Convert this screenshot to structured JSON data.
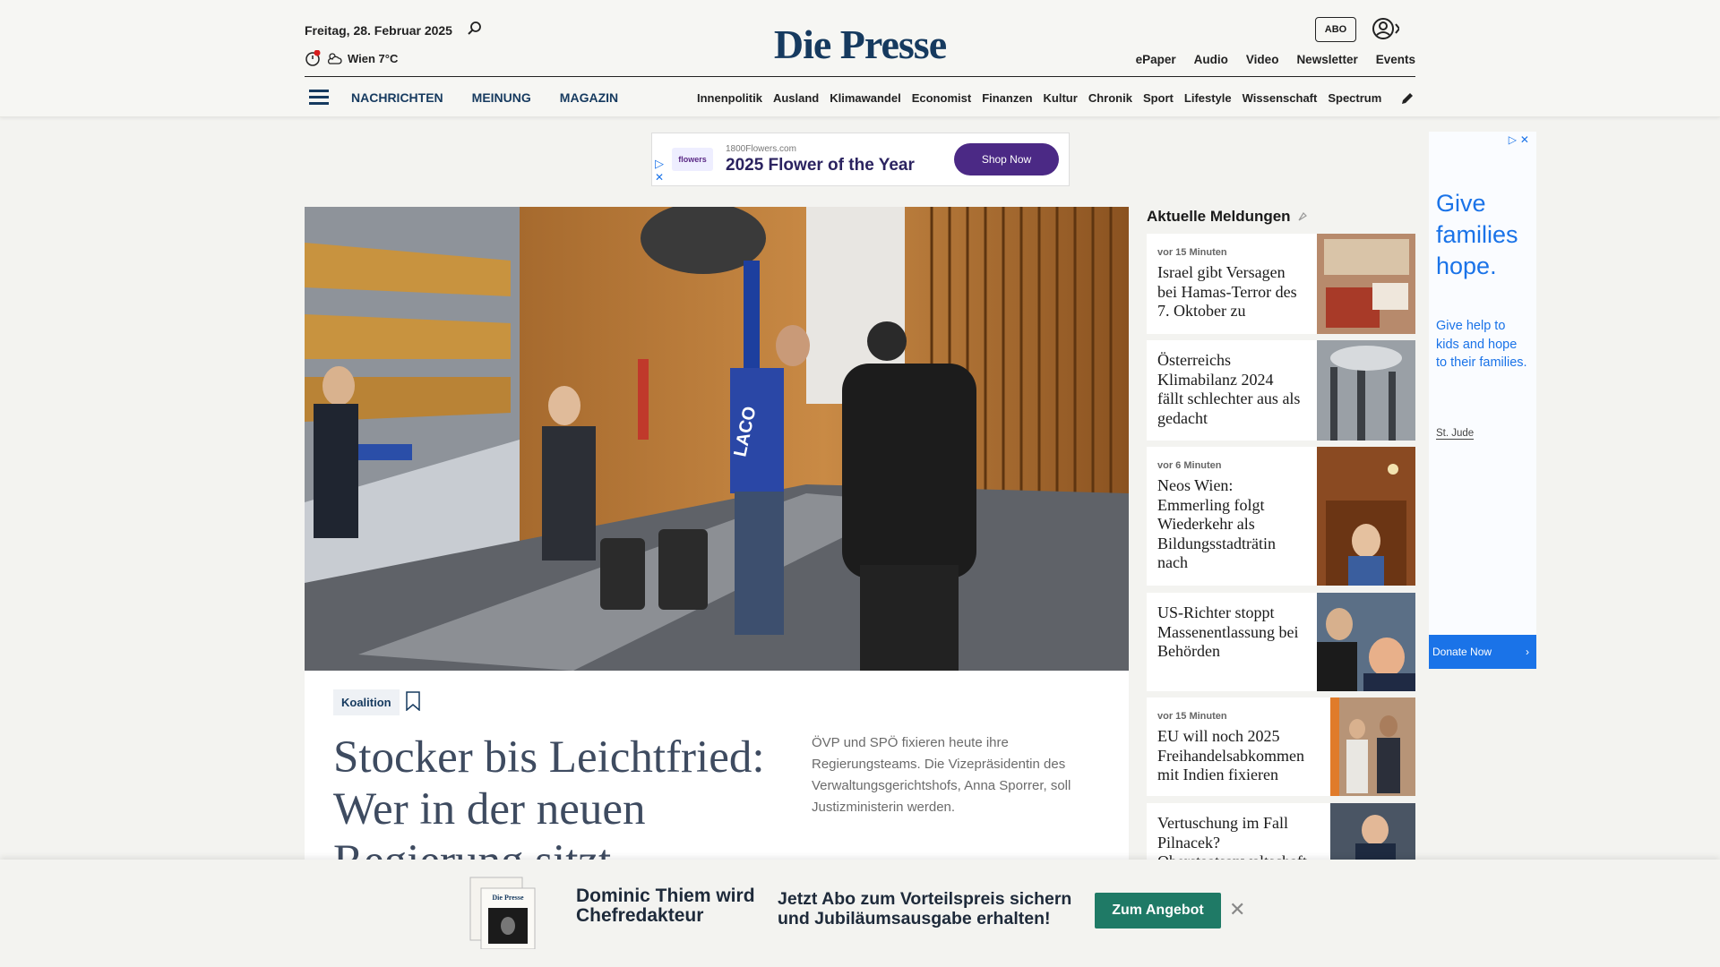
{
  "header": {
    "date": "Freitag, 28. Februar 2025",
    "weather": "Wien 7°C",
    "logo": "Die Presse",
    "abo_label": "ABO",
    "top_links": [
      "ePaper",
      "Audio",
      "Video",
      "Newsletter",
      "Events"
    ],
    "main_nav": [
      "NACHRICHTEN",
      "MEINUNG",
      "MAGAZIN"
    ],
    "sub_nav": [
      "Innenpolitik",
      "Ausland",
      "Klimawandel",
      "Economist",
      "Finanzen",
      "Kultur",
      "Chronik",
      "Sport",
      "Lifestyle",
      "Wissenschaft",
      "Spectrum"
    ]
  },
  "ad_top": {
    "source": "1800Flowers.com",
    "logo_text": "flowers",
    "title": "2025 Flower of the Year",
    "button": "Shop Now"
  },
  "article": {
    "tag": "Koalition",
    "headline": "Stocker bis Leichtfried: Wer in der neuen Regierung sitzt",
    "teaser": "ÖVP und SPÖ fixieren heute ihre Regierungsteams. Die Vizepräsidentin des Verwaltungsgerichtshofs, Anna Sporrer, soll Justizministerin werden.",
    "hero_shirt_text": "LACO"
  },
  "sidebar": {
    "title": "Aktuelle Meldungen",
    "items": [
      {
        "time": "vor 15 Minuten",
        "title": "Israel gibt Versagen bei Hamas-Terror des 7. Oktober zu"
      },
      {
        "time": "",
        "title": "Österreichs Klimabilanz 2024 fällt schlechter aus als gedacht"
      },
      {
        "time": "vor 6 Minuten",
        "title": "Neos Wien: Emmerling folgt Wiederkehr als Bildungsstadträtin nach"
      },
      {
        "time": "",
        "title": "US-Richter stoppt Massenentlassung bei Behörden"
      },
      {
        "time": "vor 15 Minuten",
        "title": "EU will noch 2025 Freihandelsabkommen mit Indien fixieren"
      },
      {
        "time": "",
        "title": "Vertuschung im Fall Pilnacek? Oberstaatsanwaltschaft"
      }
    ]
  },
  "ad_right": {
    "headline": "Give families hope.",
    "body": "Give help to kids and hope to their families.",
    "brand": "St. Jude",
    "button": "Donate Now"
  },
  "promo": {
    "title": "Dominic Thiem wird Chefredakteur",
    "text": "Jetzt Abo zum Vorteilspreis sichern und Jubiläumsausgabe erhalten!",
    "button": "Zum Angebot",
    "paper_label": "Die Presse"
  },
  "colors": {
    "brand": "#163a5f",
    "headline": "#3e4b60",
    "promo_button": "#1f7a66",
    "ad_accent": "#1a73e8"
  }
}
